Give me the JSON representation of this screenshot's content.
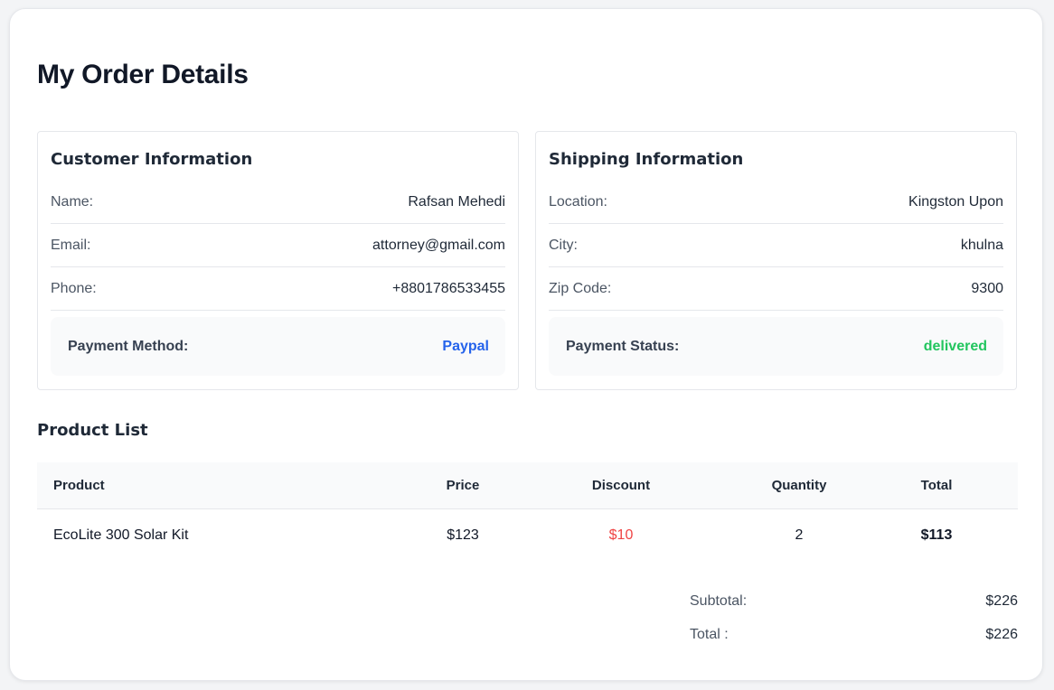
{
  "page": {
    "title": "My Order Details"
  },
  "customer": {
    "title": "Customer Information",
    "rows": [
      {
        "label": "Name:",
        "value": "Rafsan Mehedi"
      },
      {
        "label": "Email:",
        "value": "attorney@gmail.com"
      },
      {
        "label": "Phone:",
        "value": "+8801786533455"
      }
    ],
    "payment_method_label": "Payment Method:",
    "payment_method_value": "Paypal"
  },
  "shipping": {
    "title": "Shipping Information",
    "rows": [
      {
        "label": "Location:",
        "value": "Kingston Upon"
      },
      {
        "label": "City:",
        "value": "khulna"
      },
      {
        "label": "Zip Code:",
        "value": "9300"
      }
    ],
    "payment_status_label": "Payment Status:",
    "payment_status_value": "delivered"
  },
  "products": {
    "title": "Product List",
    "columns": [
      "Product",
      "Price",
      "Discount",
      "Quantity",
      "Total"
    ],
    "rows": [
      {
        "product": "EcoLite 300 Solar Kit",
        "price": "$123",
        "discount": "$10",
        "quantity": "2",
        "total": "$113"
      }
    ]
  },
  "summary": {
    "subtotal_label": "Subtotal:",
    "subtotal_value": "$226",
    "total_label": "Total :",
    "total_value": "$226"
  },
  "colors": {
    "accent_blue": "#2563eb",
    "status_green": "#22c55e",
    "discount_red": "#ef4444"
  }
}
